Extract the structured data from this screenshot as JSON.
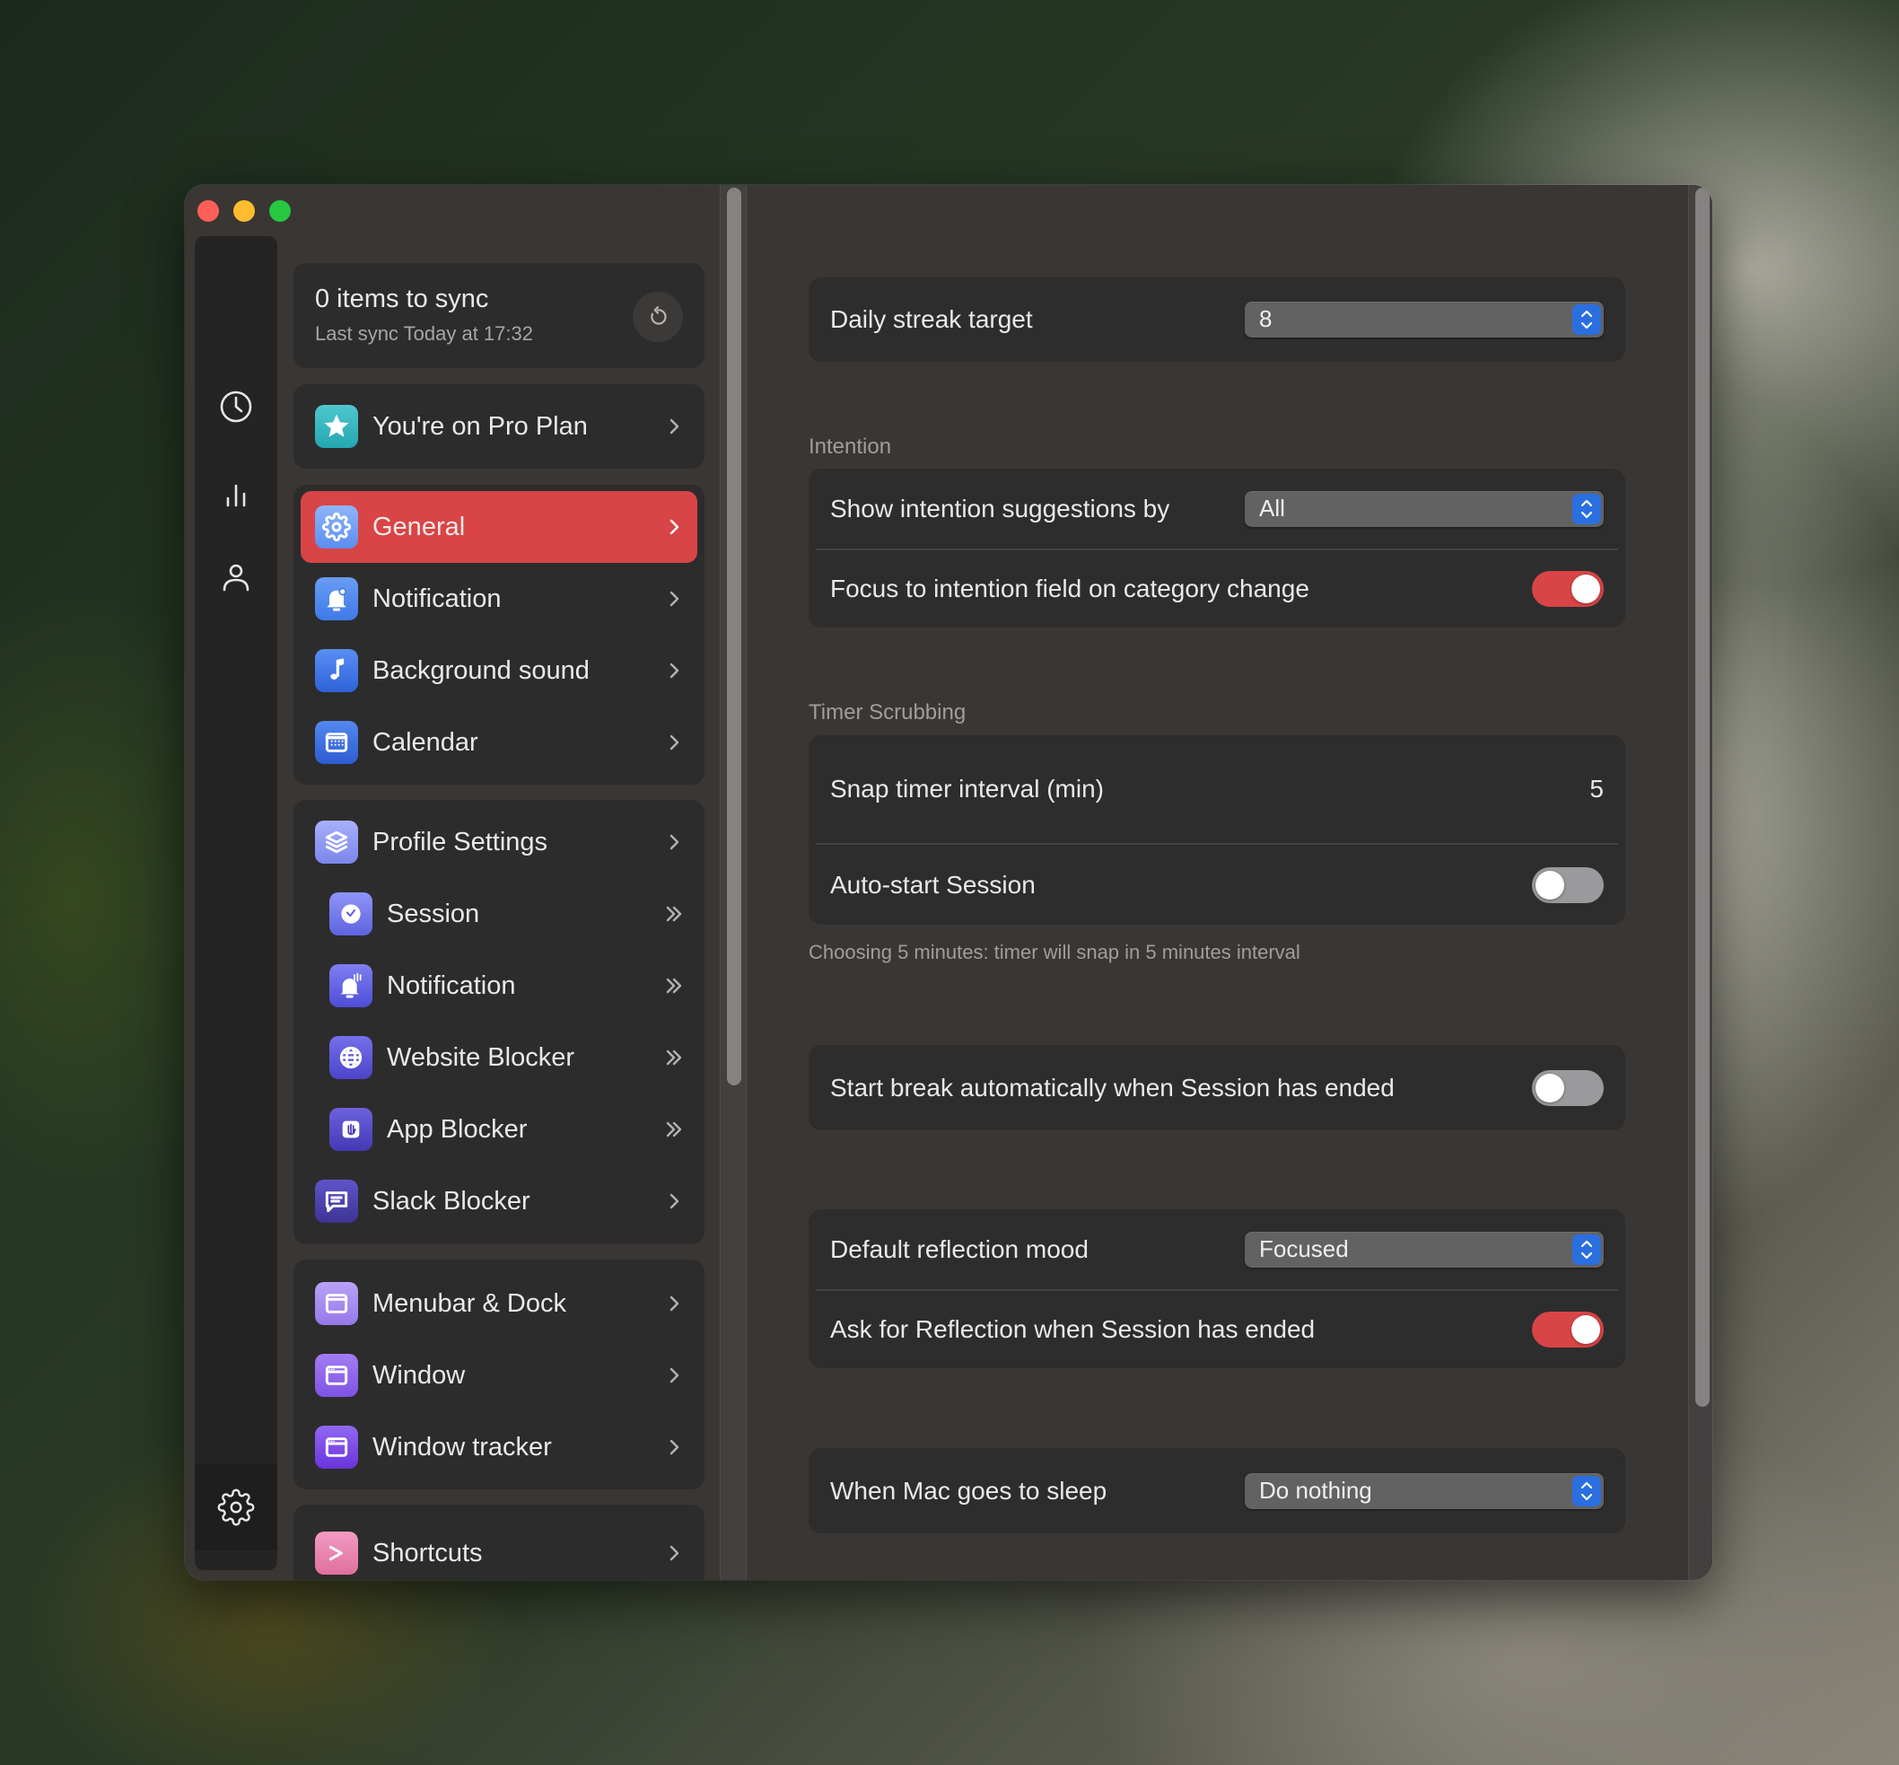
{
  "window": {
    "controls": [
      "close",
      "minimize",
      "zoom"
    ]
  },
  "rail": {
    "items": [
      {
        "icon": "clock-icon",
        "label": "Timer"
      },
      {
        "icon": "chart-icon",
        "label": "Statistics"
      },
      {
        "icon": "person-icon",
        "label": "Account"
      },
      {
        "icon": "gear-icon",
        "label": "Settings",
        "active": true
      }
    ]
  },
  "sync": {
    "title": "0 items to sync",
    "subtitle": "Last sync Today at 17:32",
    "button_icon": "refresh-icon"
  },
  "plan": {
    "label": "You're on Pro Plan",
    "icon": "star-icon"
  },
  "groups": [
    {
      "items": [
        {
          "label": "General",
          "icon": "gear-icon",
          "active": true,
          "color": "#5b8ef0"
        },
        {
          "label": "Notification",
          "icon": "bell-icon",
          "color": "#3f7ae8"
        },
        {
          "label": "Background sound",
          "icon": "music-note-icon",
          "color": "#3a6fe0"
        },
        {
          "label": "Calendar",
          "icon": "calendar-icon",
          "color": "#3565d8"
        }
      ]
    },
    {
      "items": [
        {
          "label": "Profile Settings",
          "icon": "layers-icon",
          "color": "#8a8ef0"
        },
        {
          "label": "Session",
          "icon": "alarm-clock-icon",
          "sub": true,
          "color": "#6f74e8"
        },
        {
          "label": "Notification",
          "icon": "bell-ringing-icon",
          "sub": true,
          "color": "#5e5ee0"
        },
        {
          "label": "Website Blocker",
          "icon": "globe-icon",
          "sub": true,
          "color": "#5a55d0"
        },
        {
          "label": "App Blocker",
          "icon": "hand-icon",
          "sub": true,
          "color": "#5549c0"
        },
        {
          "label": "Slack Blocker",
          "icon": "chat-bubble-icon",
          "color": "#4e42a8"
        }
      ]
    },
    {
      "items": [
        {
          "label": "Menubar & Dock",
          "icon": "menubar-icon",
          "color": "#a48af0"
        },
        {
          "label": "Window",
          "icon": "window-icon",
          "color": "#8e64ec"
        },
        {
          "label": "Window tracker",
          "icon": "window-tracker-icon",
          "color": "#7c48e4"
        }
      ]
    },
    {
      "items": [
        {
          "label": "Shortcuts",
          "icon": "terminal-icon",
          "color": "#e87aa8"
        }
      ]
    }
  ],
  "main": {
    "daily_streak": {
      "label": "Daily streak target",
      "value": "8"
    },
    "intention": {
      "section": "Intention",
      "suggestions": {
        "label": "Show intention suggestions by",
        "value": "All"
      },
      "focus_field": {
        "label": "Focus to intention field on category change",
        "on": true
      }
    },
    "timer_scrubbing": {
      "section": "Timer Scrubbing",
      "snap_interval": {
        "label": "Snap timer interval (min)",
        "value": "5"
      },
      "auto_start": {
        "label": "Auto-start Session",
        "on": false
      },
      "hint": "Choosing 5 minutes: timer will snap in 5 minutes interval"
    },
    "start_break": {
      "label": "Start break automatically when Session has ended",
      "on": false
    },
    "reflection": {
      "mood": {
        "label": "Default reflection mood",
        "value": "Focused"
      },
      "ask": {
        "label": "Ask for Reflection when Session has ended",
        "on": true
      }
    },
    "sleep": {
      "label": "When Mac goes to sleep",
      "value": "Do nothing"
    }
  },
  "colors": {
    "accent": "#d94446",
    "stepper": "#2a6fe0",
    "toggle_off": "#9a999b"
  }
}
